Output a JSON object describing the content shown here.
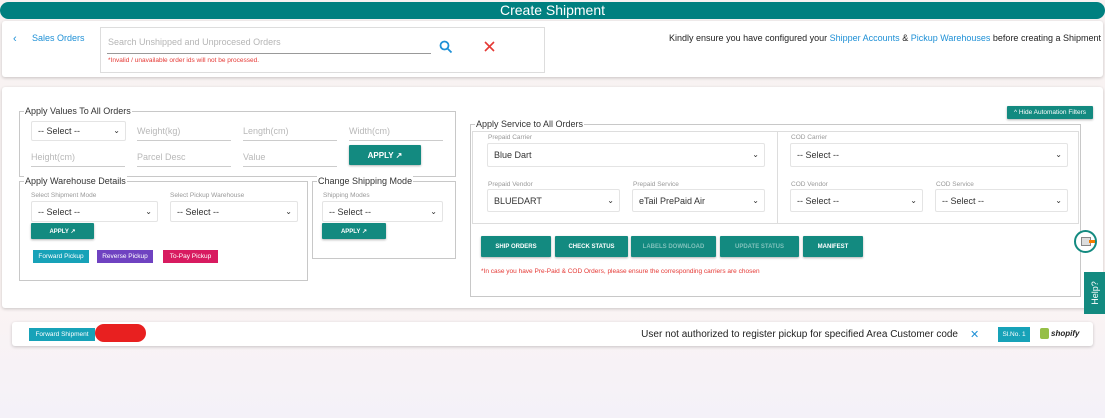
{
  "header": {
    "title": "Create Shipment"
  },
  "search": {
    "back_label": "Sales Orders",
    "placeholder": "Search Unshipped and Unprocesed Orders",
    "note": "*Invalid / unavailable order ids will not be processed.",
    "info_prefix": "Kindly ensure you have configured your ",
    "shipper_link": "Shipper Accounts",
    "amp": " & ",
    "warehouse_link": "Pickup Warehouses",
    "info_suffix": " before creating a Shipment"
  },
  "apply_values": {
    "legend": "Apply Values To All Orders",
    "select": "-- Select --",
    "weight": "Weight(kg)",
    "length": "Length(cm)",
    "width": "Width(cm)",
    "height": "Height(cm)",
    "parcel_desc": "Parcel Desc",
    "value": "Value",
    "apply": "APPLY ↗"
  },
  "warehouse": {
    "legend": "Apply Warehouse Details",
    "mode_label": "Select Shipment Mode",
    "mode_value": "-- Select --",
    "wh_label": "Select Pickup Warehouse",
    "wh_value": "-- Select --",
    "apply": "APPLY ↗",
    "forward": "Forward Pickup",
    "reverse": "Reverse Pickup",
    "topay": "To-Pay Pickup"
  },
  "shipping_mode": {
    "legend": "Change Shipping Mode",
    "label": "Shipping Modes",
    "value": "-- Select --",
    "apply": "APPLY ↗"
  },
  "hide_filters": "^ Hide Automation Filters",
  "service": {
    "legend": "Apply Service to All Orders",
    "prepaid_carrier_label": "Prepaid Carrier",
    "prepaid_carrier": "Blue Dart",
    "cod_carrier_label": "COD Carrier",
    "cod_carrier": "-- Select --",
    "prepaid_vendor_label": "Prepaid Vendor",
    "prepaid_vendor": "BLUEDART",
    "prepaid_service_label": "Prepaid Service",
    "prepaid_service": "eTail PrePaid Air",
    "cod_vendor_label": "COD Vendor",
    "cod_vendor": "-- Select --",
    "cod_service_label": "COD Service",
    "cod_service": "-- Select --"
  },
  "actions": {
    "ship": "SHIP ORDERS",
    "check": "CHECK STATUS",
    "labels": "LABELS DOWNLOAD",
    "update": "UPDATE STATUS",
    "manifest": "MANIFEST",
    "note": "*In case you have Pre-Paid & COD Orders, please ensure the corresponding carriers are chosen"
  },
  "help": "Help?",
  "order": {
    "badge": "Forward Shipment",
    "message": "User not authorized to register pickup for specified Area Customer code",
    "close": "✕",
    "slno": "Sl.No. 1",
    "store": "shopify"
  }
}
